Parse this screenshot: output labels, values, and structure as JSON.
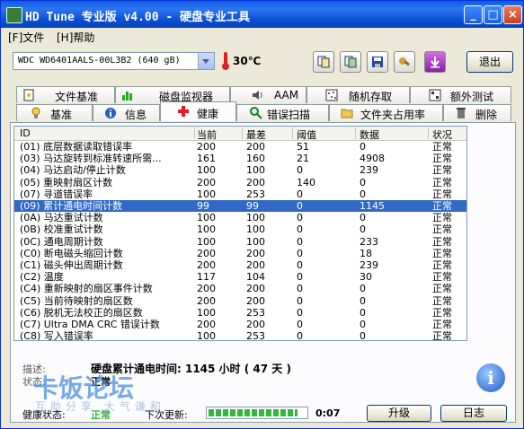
{
  "window": {
    "title": "HD Tune 专业版 v4.00 - 硬盘专业工具"
  },
  "menu": {
    "file": "[F]文件",
    "help": "[H]帮助"
  },
  "toolbar": {
    "drive": "WDC WD6401AALS-00L3B2 (640 gB)",
    "temperature": "30℃",
    "exit_label": "退出",
    "icons": [
      "copy-text-icon",
      "copy-screen-icon",
      "save-icon",
      "options-icon",
      "download-icon"
    ]
  },
  "tabs_top": [
    "文件基准",
    "磁盘监视器",
    "AAM",
    "随机存取",
    "额外测试"
  ],
  "tabs_bottom": [
    "基准",
    "信息",
    "健康",
    "错误扫描",
    "文件夹占用率",
    "删除"
  ],
  "active_tab": "健康",
  "table": {
    "columns": [
      "ID",
      "当前",
      "最差",
      "阈值",
      "数据",
      "状况"
    ],
    "rows": [
      [
        "(01) 底层数据读取错误率",
        "200",
        "200",
        "51",
        "0",
        "正常"
      ],
      [
        "(03) 马达旋转到标准转速所需...",
        "161",
        "160",
        "21",
        "4908",
        "正常"
      ],
      [
        "(04) 马达启动/停止计数",
        "100",
        "100",
        "0",
        "239",
        "正常"
      ],
      [
        "(05) 重映射扇区计数",
        "200",
        "200",
        "140",
        "0",
        "正常"
      ],
      [
        "(07) 寻道错误率",
        "100",
        "253",
        "0",
        "0",
        "正常"
      ],
      [
        "(09) 累计通电时间计数",
        "99",
        "99",
        "0",
        "1145",
        "正常"
      ],
      [
        "(0A) 马达重试计数",
        "100",
        "100",
        "0",
        "0",
        "正常"
      ],
      [
        "(0B) 校准重试计数",
        "100",
        "100",
        "0",
        "0",
        "正常"
      ],
      [
        "(0C) 通电周期计数",
        "100",
        "100",
        "0",
        "233",
        "正常"
      ],
      [
        "(C0) 断电磁头缩回计数",
        "200",
        "200",
        "0",
        "18",
        "正常"
      ],
      [
        "(C1) 磁头伸出周期计数",
        "200",
        "200",
        "0",
        "239",
        "正常"
      ],
      [
        "(C2) 温度",
        "117",
        "104",
        "0",
        "30",
        "正常"
      ],
      [
        "(C4) 重新映射的扇区事件计数",
        "200",
        "200",
        "0",
        "0",
        "正常"
      ],
      [
        "(C5) 当前待映射的扇区数",
        "200",
        "200",
        "0",
        "0",
        "正常"
      ],
      [
        "(C6) 脱机无法校正的扇区数",
        "100",
        "253",
        "0",
        "0",
        "正常"
      ],
      [
        "(C7) Ultra DMA CRC 错误计数",
        "200",
        "200",
        "0",
        "0",
        "正常"
      ],
      [
        "(C8) 写入错误率",
        "100",
        "253",
        "0",
        "0",
        "正常"
      ]
    ],
    "selected_index": 5
  },
  "details": {
    "desc_label": "描述:",
    "desc_value": "硬盘累计通电时间: 1145 小时 ( 47 天 )",
    "status_label": "状态:",
    "status_value": "正常"
  },
  "footer": {
    "health_label": "健康状态:",
    "health_value": "正常",
    "next_update_label": "下次更新:",
    "timer": "0:07",
    "progress_fraction": 0.92,
    "upgrade_label": "升级",
    "log_label": "日志"
  },
  "watermark": {
    "main": "卡饭论坛",
    "sub": "互助分享 大气谦和"
  },
  "colors": {
    "selection": "#316ac5",
    "title_bar": "#0a5fe3",
    "progress": "#2fb83a",
    "health_ok": "#2fb83a"
  }
}
